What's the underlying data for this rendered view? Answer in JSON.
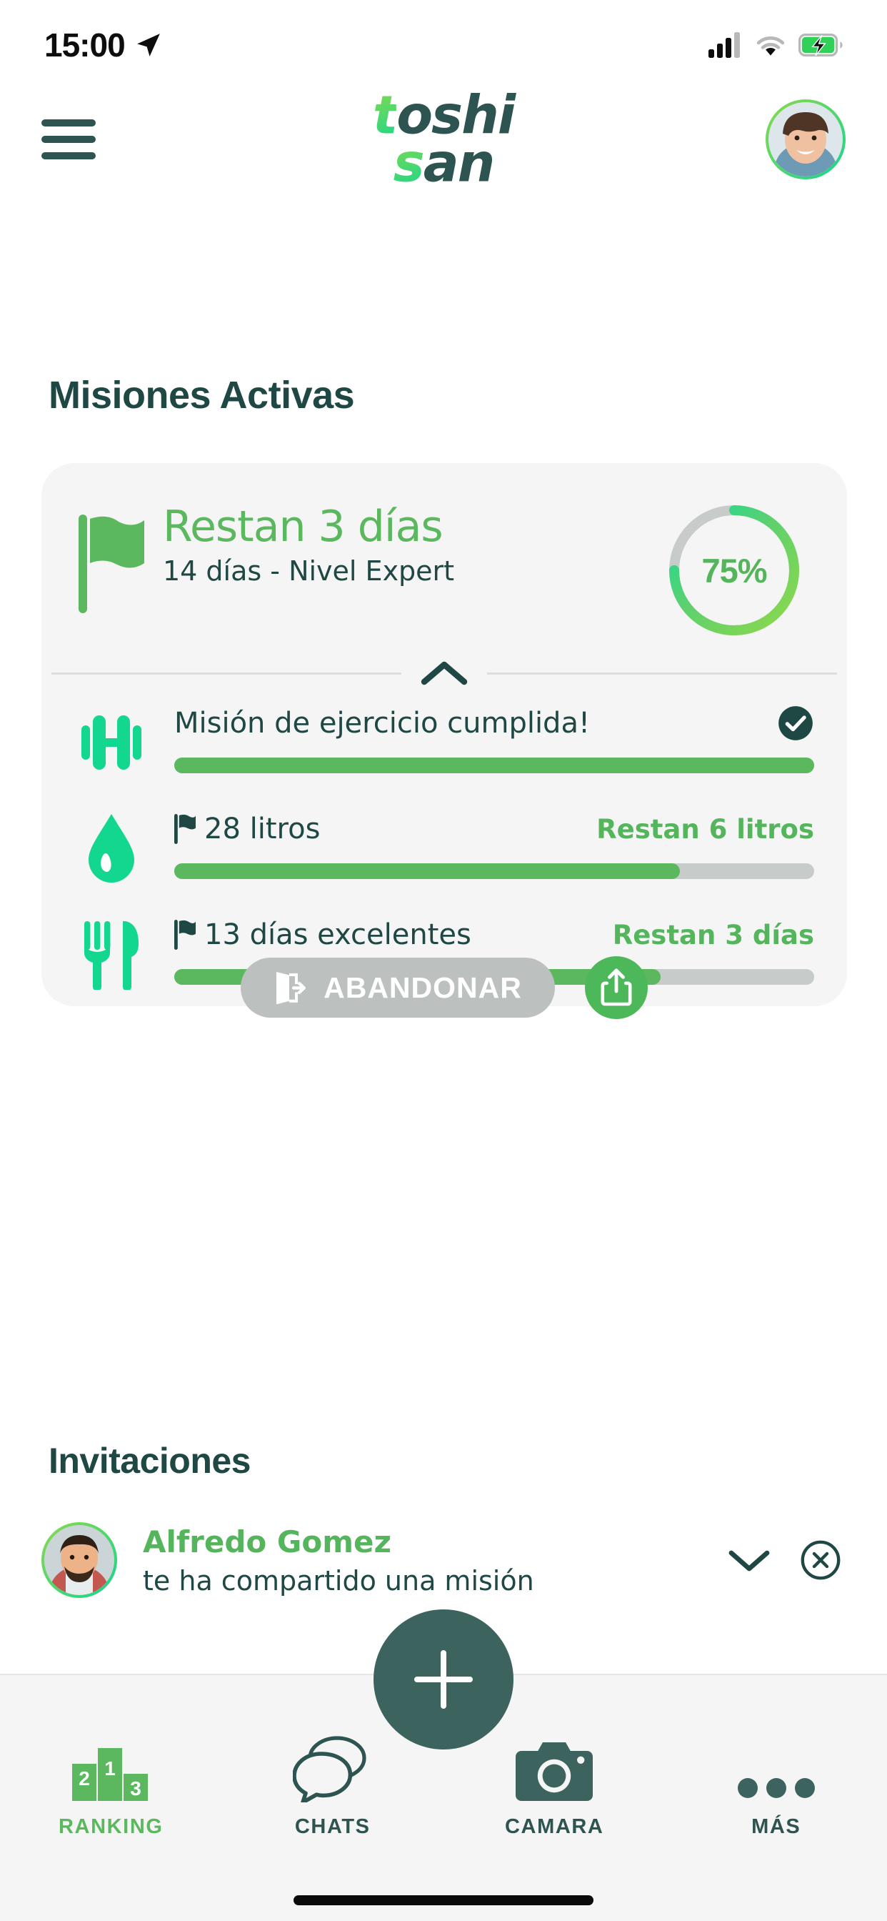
{
  "status_bar": {
    "time": "15:00",
    "location_icon": "location-arrow-icon",
    "signal_icon": "cellular-signal-icon",
    "wifi_icon": "wifi-icon",
    "battery_icon": "battery-charging-icon",
    "battery_color": "#30d158"
  },
  "header": {
    "menu_icon": "hamburger-menu-icon",
    "logo_line1": "toshi",
    "logo_line2": "san",
    "logo_line1_accent": "t",
    "logo_line1_rest": "oshi",
    "logo_line2_accent": "s",
    "logo_line2_rest": "an",
    "avatar_alt": "user-avatar",
    "brand_green": "#13d68f",
    "brand_lime": "#8ed94a",
    "brand_dark": "#2d5450"
  },
  "sections": {
    "missions_title": "Misiones Activas",
    "invitations_title": "Invitaciones"
  },
  "mission_card": {
    "flag_icon": "flag-icon",
    "title": "Restan 3 días",
    "subtitle": "14 días - Nivel Expert",
    "progress_percent_label": "75%",
    "progress_percent": 75,
    "collapse_icon": "chevron-up-icon",
    "rows": [
      {
        "icon": "dumbbell-icon",
        "label": "Misión de ejercicio cumplida!",
        "has_flag": false,
        "right": "",
        "completed": true,
        "completed_icon": "check-circle-icon",
        "progress": 100
      },
      {
        "icon": "water-drop-icon",
        "label": "28 litros",
        "has_flag": true,
        "right": "Restan 6 litros",
        "completed": false,
        "progress": 79
      },
      {
        "icon": "cutlery-icon",
        "label": "13 días excelentes",
        "has_flag": true,
        "right": "Restan 3 días",
        "completed": false,
        "progress": 76
      }
    ],
    "abandon_label": "ABANDONAR",
    "abandon_icon": "exit-door-icon",
    "share_icon": "share-icon",
    "accent_green": "#5cb85f",
    "accent_mint": "#13d68f",
    "track_gray": "#c7cbca"
  },
  "invitation": {
    "avatar_alt": "alfredo-gomez-avatar",
    "name": "Alfredo Gomez",
    "message": "te ha compartido una misión",
    "expand_icon": "chevron-down-icon",
    "dismiss_icon": "close-circle-icon"
  },
  "tabbar": {
    "fab_icon": "plus-icon",
    "items": [
      {
        "icon": "podium-ranking-icon",
        "label": "RANKING",
        "active": true
      },
      {
        "icon": "chat-bubbles-icon",
        "label": "CHATS",
        "active": false
      },
      {
        "icon": "camera-icon",
        "label": "CAMARA",
        "active": false
      },
      {
        "icon": "ellipsis-icon",
        "label": "MÁS",
        "active": false
      }
    ],
    "podium_numbers": [
      "2",
      "1",
      "3"
    ]
  }
}
